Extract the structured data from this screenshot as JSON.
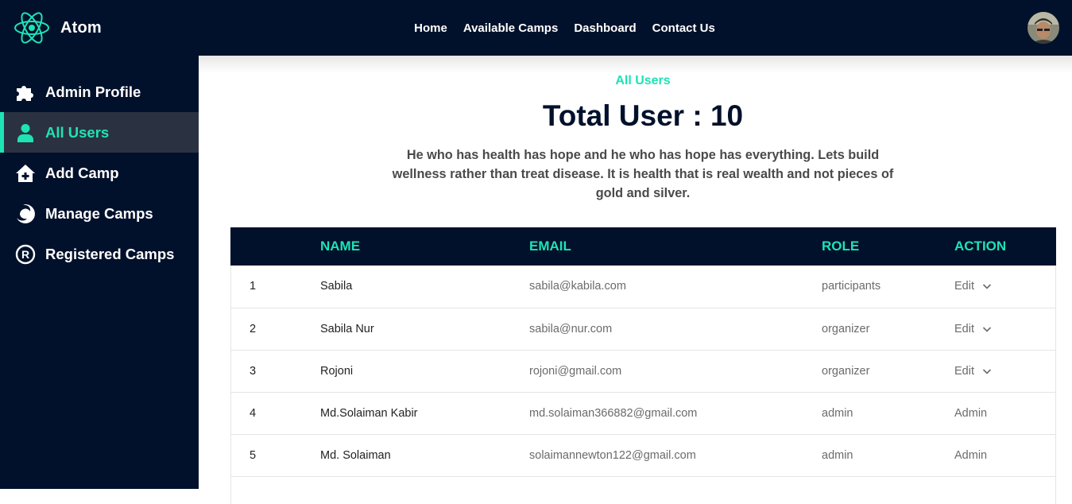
{
  "brand": {
    "name": "Atom"
  },
  "nav": {
    "items": [
      "Home",
      "Available Camps",
      "Dashboard",
      "Contact Us"
    ]
  },
  "sidebar": {
    "items": [
      {
        "label": "Admin Profile",
        "icon": "puzzle-icon",
        "active": false
      },
      {
        "label": "All Users",
        "icon": "user-icon",
        "active": true
      },
      {
        "label": "Add Camp",
        "icon": "home-plus-icon",
        "active": false
      },
      {
        "label": "Manage Camps",
        "icon": "edge-swirl-icon",
        "active": false
      },
      {
        "label": "Registered Camps",
        "icon": "registered-icon",
        "active": false
      }
    ]
  },
  "main": {
    "section_tag": "All Users",
    "heading": "Total User : 10",
    "quote": "He who has health has hope and he who has hope has everything. Lets build wellness rather than treat disease. It is health that is real wealth and not pieces of gold and silver."
  },
  "table": {
    "headers": [
      "",
      "NAME",
      "EMAIL",
      "ROLE",
      "ACTION"
    ],
    "rows": [
      {
        "index": "1",
        "name": "Sabila",
        "email": "sabila@kabila.com",
        "role": "participants",
        "action": "Edit",
        "dropdown": true
      },
      {
        "index": "2",
        "name": "Sabila Nur",
        "email": "sabila@nur.com",
        "role": "organizer",
        "action": "Edit",
        "dropdown": true
      },
      {
        "index": "3",
        "name": "Rojoni",
        "email": "rojoni@gmail.com",
        "role": "organizer",
        "action": "Edit",
        "dropdown": true
      },
      {
        "index": "4",
        "name": "Md.Solaiman Kabir",
        "email": "md.solaiman366882@gmail.com",
        "role": "admin",
        "action": "Admin",
        "dropdown": false
      },
      {
        "index": "5",
        "name": "Md. Solaiman",
        "email": "solaimannewton122@gmail.com",
        "role": "admin",
        "action": "Admin",
        "dropdown": false
      }
    ]
  },
  "colors": {
    "navy": "#02112b",
    "accent": "#1ee3b5",
    "active_bg": "#2a3241"
  }
}
